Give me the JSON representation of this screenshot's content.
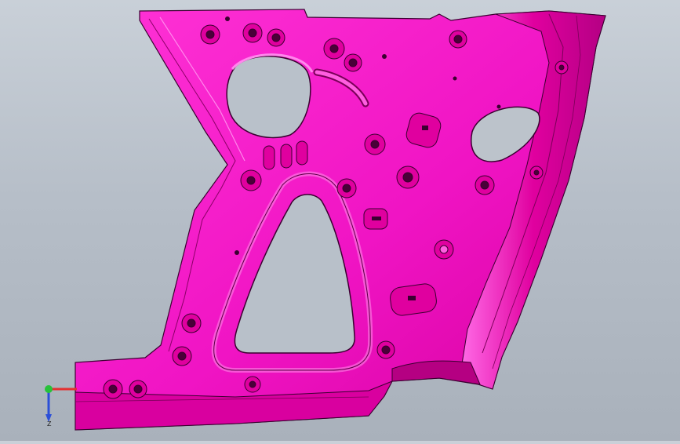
{
  "viewport": {
    "background_top": "#c9d0d8",
    "background_bottom": "#a9b1bb"
  },
  "model": {
    "part_color": "#f014c4",
    "part_dark": "#c80096",
    "part_light": "#ff4fe0",
    "edge_color": "#3a0030"
  },
  "triad": {
    "x_color": "#e53030",
    "y_color": "#27c23a",
    "z_color": "#2b4fd8",
    "z_label": "Z"
  }
}
